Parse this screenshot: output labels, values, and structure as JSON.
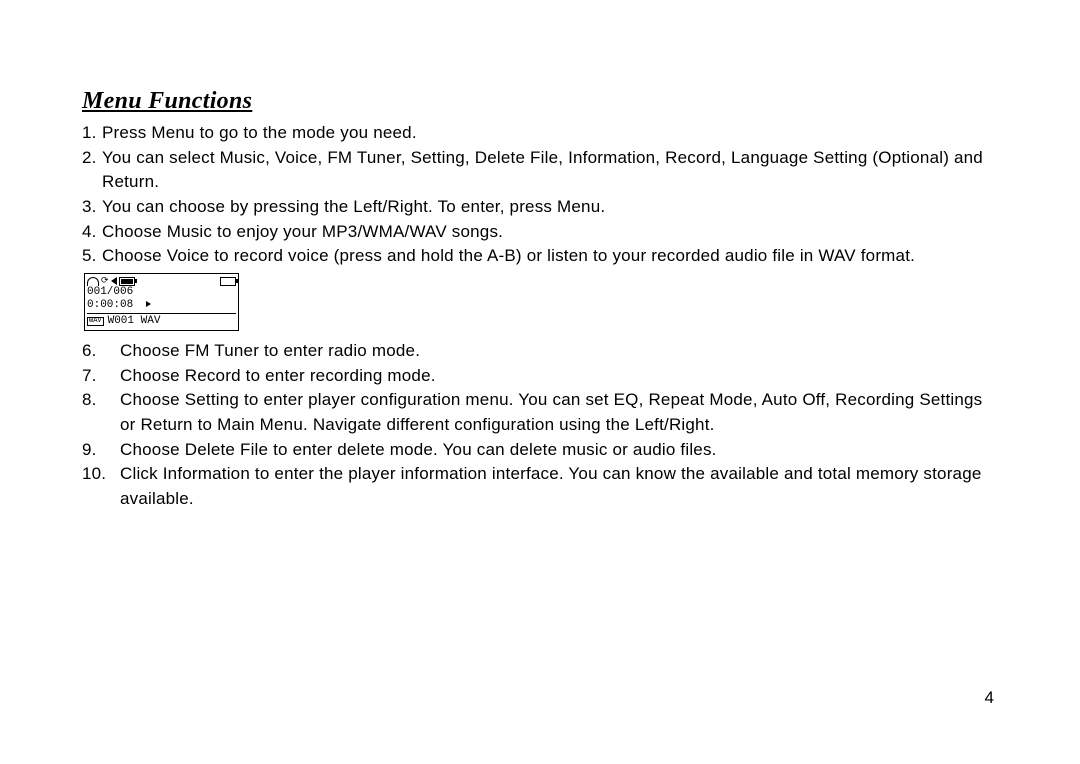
{
  "heading": "Menu Functions",
  "list1": [
    {
      "n": "1.",
      "t": "Press Menu to go to the mode you need."
    },
    {
      "n": "2.",
      "t": "You can select Music, Voice, FM Tuner, Setting, Delete File, Information, Record, Language Setting (Optional) and Return."
    },
    {
      "n": "3.",
      "t": "You can choose by pressing the Left/Right. To enter, press Menu."
    },
    {
      "n": "4.",
      "t": "Choose Music to enjoy your MP3/WMA/WAV songs."
    },
    {
      "n": "5.",
      "t": "Choose Voice to record voice (press and hold the A-B) or listen to your recorded audio file in WAV format."
    }
  ],
  "screen": {
    "track": "001/006",
    "time": "0:00:08",
    "file_label": "W001 WAV",
    "file_type_badge": "WAV"
  },
  "list2": [
    {
      "n": "6.",
      "t": "Choose FM Tuner to enter radio mode."
    },
    {
      "n": "7.",
      "t": "Choose Record to enter recording mode."
    },
    {
      "n": "8.",
      "t": "Choose Setting to enter player configuration menu. You can set EQ, Repeat Mode, Auto Off, Recording Settings or Return to Main Menu. Navigate different configuration using the Left/Right."
    },
    {
      "n": "9.",
      "t": "Choose Delete File to enter delete mode. You can delete music or audio files."
    },
    {
      "n": "10.",
      "t": "Click Information to enter the player information interface. You can know the available and total memory storage available."
    }
  ],
  "page_number": "4"
}
